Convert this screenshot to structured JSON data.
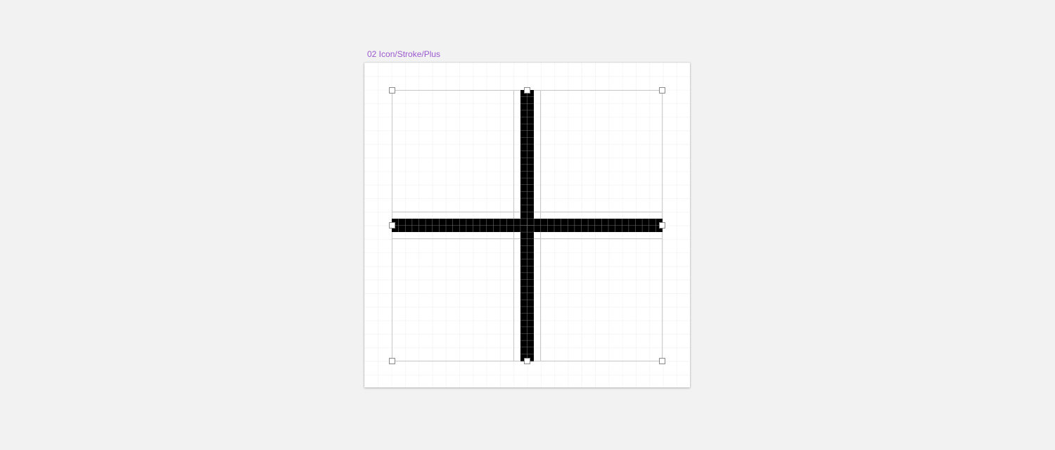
{
  "frame": {
    "label": "02 Icon/Stroke/Plus"
  },
  "icon": {
    "name": "plus-icon",
    "stroke_color": "#000000",
    "grid_color": "#6b6b6b",
    "bounds_color": "#c8c8c8",
    "handle_color": "#8a8a8a",
    "label_color": "#9b59d0"
  }
}
